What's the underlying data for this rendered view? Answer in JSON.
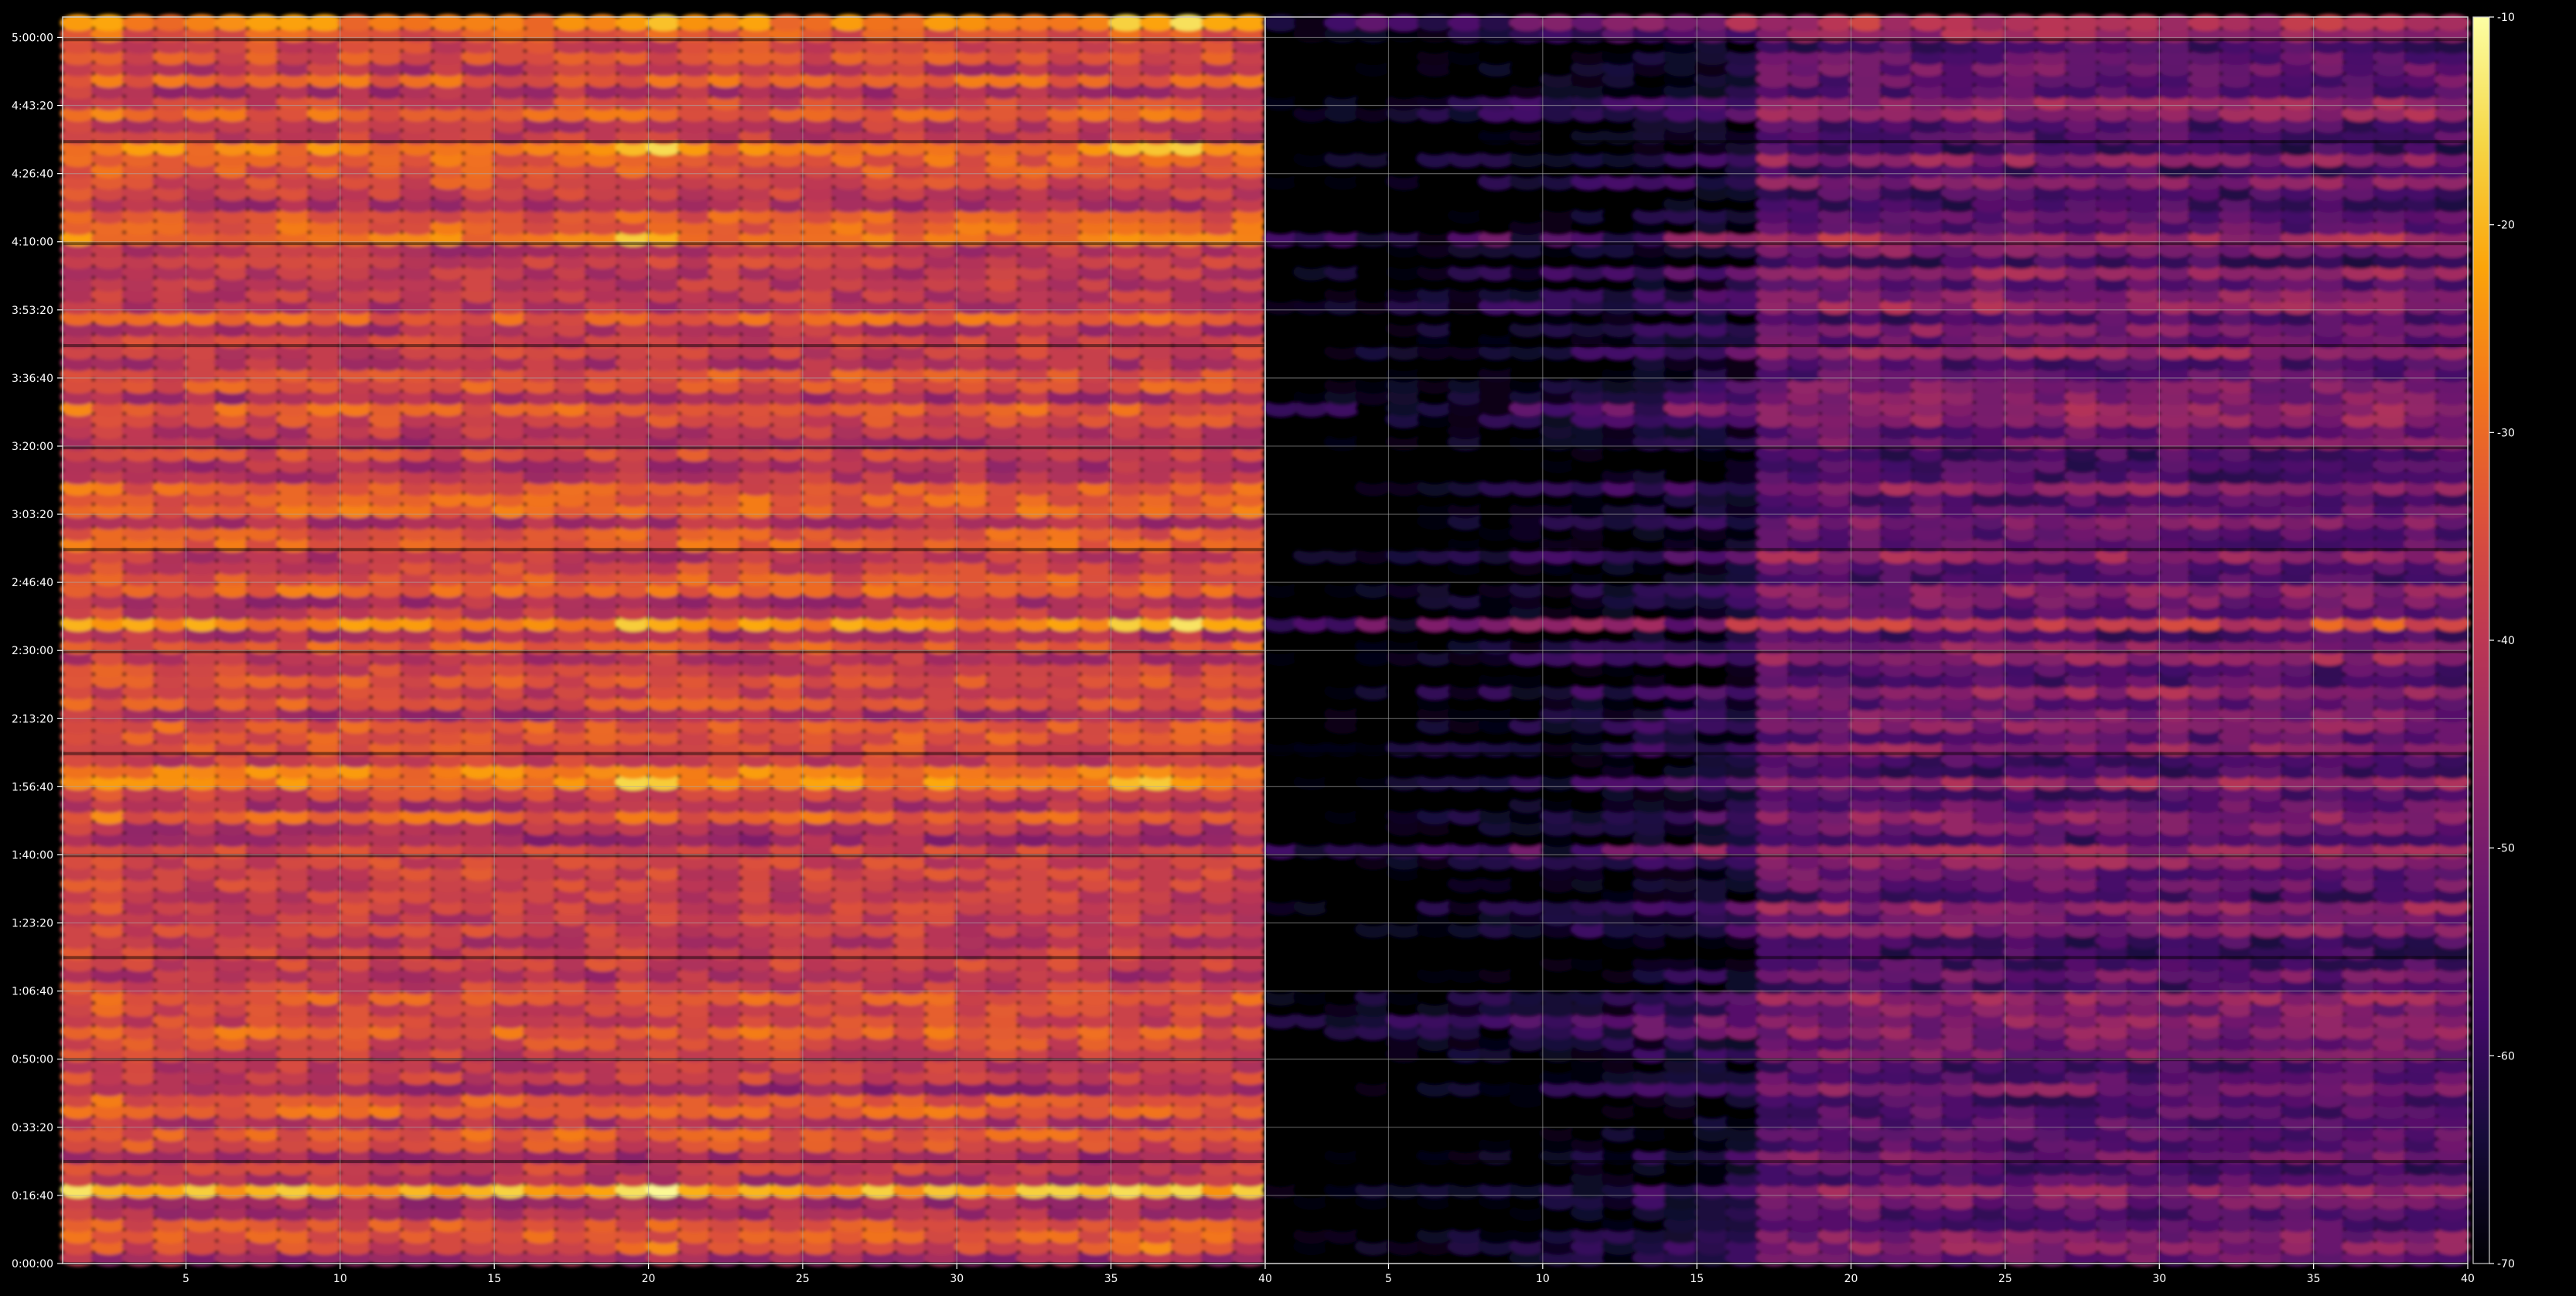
{
  "chart_data": {
    "type": "heatmap",
    "title": "",
    "xlabel": "",
    "ylabel": "",
    "panels": [
      {
        "name": "",
        "xlim": [
          1,
          40
        ],
        "ylim_seconds": [
          0,
          18300
        ],
        "x_tick_labels": [
          "5",
          "10",
          "15",
          "20",
          "25",
          "30",
          "35",
          "40"
        ],
        "x_tick_values": [
          5,
          10,
          15,
          20,
          25,
          30,
          35,
          40
        ],
        "y_tick_labels": [
          "0:00:00",
          "0:16:40",
          "0:33:20",
          "0:50:00",
          "1:06:40",
          "1:23:20",
          "1:40:00",
          "1:56:40",
          "2:13:20",
          "2:30:00",
          "2:46:40",
          "3:03:20",
          "3:20:00",
          "3:36:40",
          "3:53:20",
          "4:10:00",
          "4:26:40",
          "4:43:20",
          "5:00:00"
        ],
        "y_tick_values": [
          0,
          1000,
          2000,
          3000,
          4000,
          5000,
          6000,
          7000,
          8000,
          9000,
          10000,
          11000,
          12000,
          13000,
          14000,
          15000,
          16000,
          17000,
          18000
        ],
        "grid": true,
        "level_description": "bright / high levels across most of the panel",
        "base_level": -38,
        "hot_rows_seconds": [
          300,
          1100,
          3500,
          6000,
          7100,
          9400,
          12500,
          15100,
          16400,
          18200
        ],
        "hot_spot_columns": [
          19,
          20,
          35,
          36,
          37
        ]
      },
      {
        "name": "",
        "xlim": [
          1,
          40
        ],
        "ylim_seconds": [
          0,
          18300
        ],
        "x_tick_labels": [
          "5",
          "10",
          "15",
          "20",
          "25",
          "30",
          "35",
          "40"
        ],
        "x_tick_values": [
          5,
          10,
          15,
          20,
          25,
          30,
          35,
          40
        ],
        "grid": true,
        "level_description": "darker / lower levels, very dark band at low x",
        "base_level": -52,
        "dark_region_x": [
          1,
          16
        ],
        "hot_rows_seconds": [
          3500,
          6000,
          9400,
          12500,
          15100,
          18200
        ],
        "hot_spot_columns": [
          19,
          20,
          35,
          36,
          37
        ]
      }
    ],
    "colorbar": {
      "colormap": "inferno",
      "range": [
        -70,
        -10
      ],
      "tick_labels": [
        "-10",
        "-20",
        "-30",
        "-40",
        "-50",
        "-60",
        "-70"
      ],
      "tick_values": [
        -10,
        -20,
        -30,
        -40,
        -50,
        -60,
        -70
      ]
    }
  }
}
